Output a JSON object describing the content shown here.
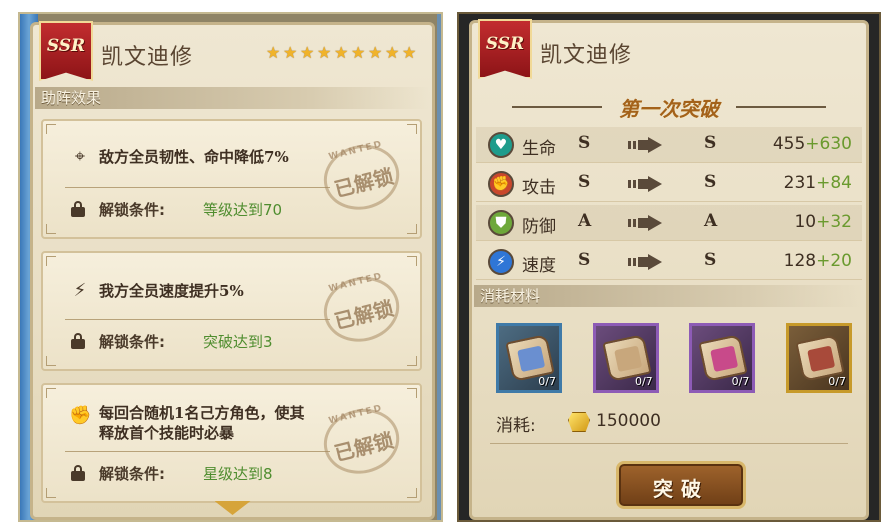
{
  "left_panel": {
    "rarity": "SSR",
    "hero_name": "凯文迪修",
    "star_count": 9,
    "section_title": "助阵效果",
    "stamp_word": "WANTED",
    "effects": [
      {
        "icon": "target-icon",
        "text": "敌方全员韧性、命中降低7%",
        "cond_label": "解锁条件:",
        "cond_value": "等级达到70",
        "stamp": "已解锁"
      },
      {
        "icon": "lightning-icon",
        "text": "我方全员速度提升5%",
        "cond_label": "解锁条件:",
        "cond_value": "突破达到3",
        "stamp": "已解锁"
      },
      {
        "icon": "fist-icon",
        "text": "每回合随机1名己方角色，使其释放首个技能时必暴",
        "cond_label": "解锁条件:",
        "cond_value": "星级达到8",
        "stamp": "已解锁"
      }
    ]
  },
  "right_panel": {
    "rarity": "SSR",
    "hero_name": "凯文迪修",
    "break_title": "第一次突破",
    "stats": [
      {
        "icon": "heart-icon",
        "color": "#1e9c8c",
        "name": "生命",
        "from": "S",
        "to": "S",
        "base": "455",
        "bonus": "+630"
      },
      {
        "icon": "fist-icon",
        "color": "#c9472c",
        "name": "攻击",
        "from": "S",
        "to": "S",
        "base": "231",
        "bonus": "+84"
      },
      {
        "icon": "shield-icon",
        "color": "#6ea83a",
        "name": "防御",
        "from": "A",
        "to": "A",
        "base": "10",
        "bonus": "+32"
      },
      {
        "icon": "lightning-icon",
        "color": "#2f76d6",
        "name": "速度",
        "from": "S",
        "to": "S",
        "base": "128",
        "bonus": "+20"
      }
    ],
    "materials_title": "消耗材料",
    "materials": [
      {
        "frame": "blue",
        "ink": "#6a8fd0",
        "count": "0/7"
      },
      {
        "frame": "purple",
        "ink": "#c8a77c",
        "count": "0/7"
      },
      {
        "frame": "purple",
        "ink": "#c84a8a",
        "count": "0/7"
      },
      {
        "frame": "gold",
        "ink": "#a84a3a",
        "count": "0/7"
      }
    ],
    "cost_label": "消耗:",
    "cost_value": "150000",
    "break_button": "突破"
  }
}
